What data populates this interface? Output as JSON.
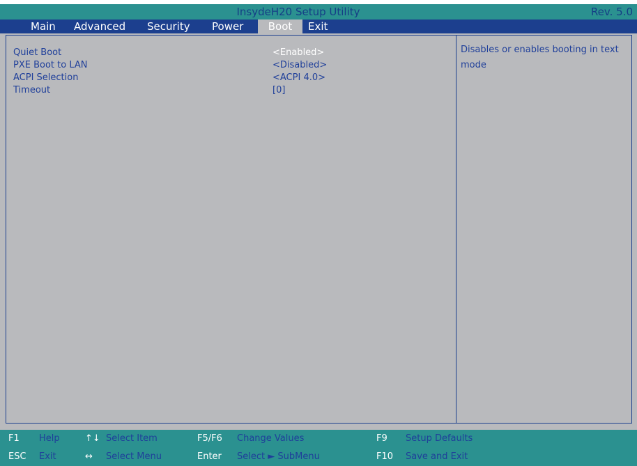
{
  "app": {
    "title": "InsydeH20 Setup Utility",
    "revision": "Rev. 5.0"
  },
  "menu": {
    "tabs": [
      {
        "label": "Main"
      },
      {
        "label": "Advanced"
      },
      {
        "label": "Security"
      },
      {
        "label": "Power"
      },
      {
        "label": "Boot",
        "active": true
      },
      {
        "label": "Exit"
      }
    ]
  },
  "settings": [
    {
      "label": "Quiet Boot",
      "value": "<Enabled>",
      "selected": true
    },
    {
      "label": "PXE Boot to LAN",
      "value": "<Disabled>"
    },
    {
      "label": "ACPI Selection",
      "value": "<ACPI 4.0>"
    },
    {
      "label": "Timeout",
      "value": "[0]"
    }
  ],
  "help": {
    "text": "Disables or enables booting in text mode"
  },
  "footer": {
    "row1": [
      {
        "key": "F1",
        "desc": "Help"
      },
      {
        "key": "↑↓",
        "desc": "Select Item"
      },
      {
        "key": "F5/F6",
        "desc": "Change Values"
      },
      {
        "key": "F9",
        "desc": "Setup Defaults"
      }
    ],
    "row2": [
      {
        "key": "ESC",
        "desc": "Exit"
      },
      {
        "key": "↔",
        "desc": "Select Menu"
      },
      {
        "key": "Enter",
        "desc": "Select ► SubMenu"
      },
      {
        "key": "F10",
        "desc": "Save and Exit"
      }
    ]
  },
  "colors": {
    "teal": "#2b9190",
    "navy": "#1c3f8e",
    "panel": "#b9babd",
    "text": "#1f3f9a"
  }
}
